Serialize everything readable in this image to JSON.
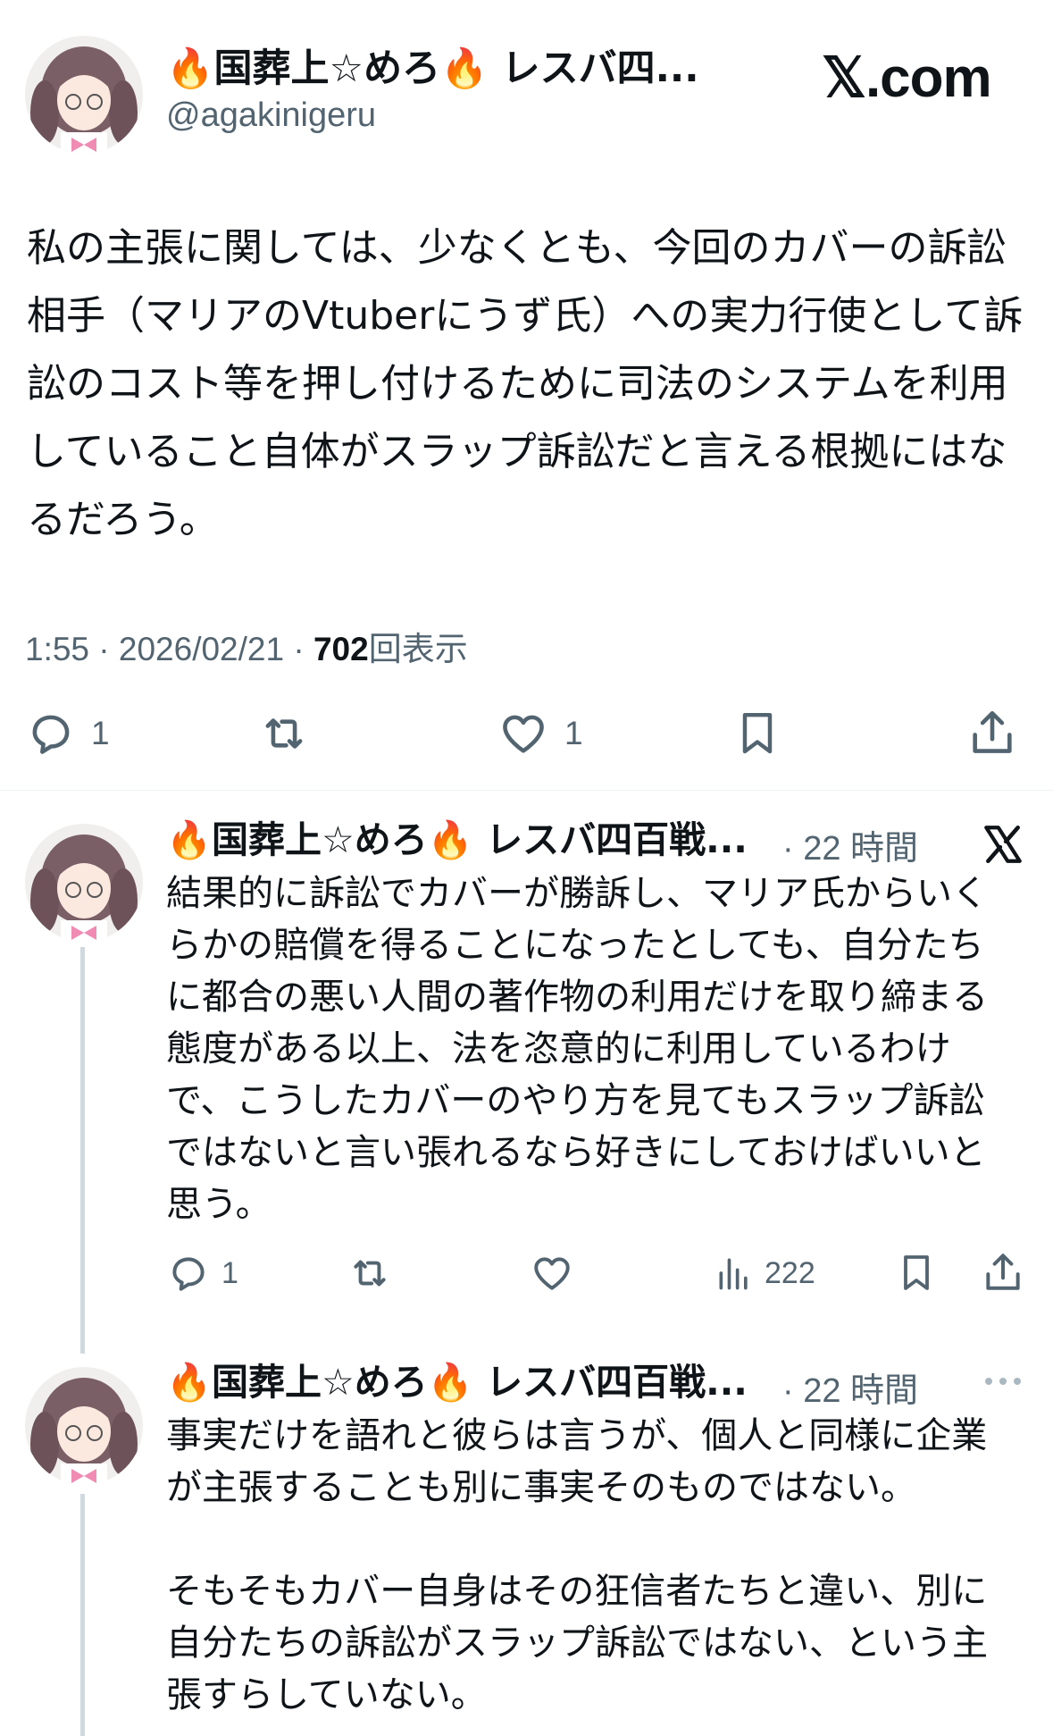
{
  "main_tweet": {
    "author_name": "🔥国葬上☆めろ🔥 レスバ四...",
    "handle": "@agakinigeru",
    "site_label": "𝕏.com",
    "text": "私の主張に関しては、少なくとも、今回のカバーの訴訟相手（マリアのVtuberにうず氏）への実力行使として訴訟のコスト等を押し付けるために司法のシステムを利用していること自体がスラップ訴訟だと言える根拠にはなるだろう。",
    "time": "1:55 · 2026/02/21 · ",
    "views_count": "702",
    "views_label": "回表示",
    "reply_count": "1",
    "like_count": "1"
  },
  "replies": [
    {
      "author_name": "🔥国葬上☆めろ🔥 レスバ四百戦...",
      "time": "· 22 時間",
      "text": "結果的に訴訟でカバーが勝訴し、マリア氏からいくらかの賠償を得ることになったとしても、自分たちに都合の悪い人間の著作物の利用だけを取り締まる態度がある以上、法を恣意的に利用しているわけで、こうしたカバーのやり方を見てもスラップ訴訟ではないと言い張れるなら好きにしておけばいいと思う。",
      "reply_count": "1",
      "views_count": "222"
    },
    {
      "author_name": "🔥国葬上☆めろ🔥 レスバ四百戦...",
      "time": "· 22 時間",
      "text_1": "事実だけを語れと彼らは言うが、個人と同様に企業が主張することも別に事実そのものではない。",
      "text_2": "そもそもカバー自身はその狂信者たちと違い、別に自分たちの訴訟がスラップ訴訟ではない、という主張すらしていない。"
    }
  ],
  "icons": [
    "avatar",
    "reply-icon",
    "retweet-icon",
    "like-icon",
    "bookmark-icon",
    "share-icon",
    "views-icon",
    "x-logo-icon",
    "more-icon"
  ],
  "colors": {
    "text": "#0f1419",
    "secondary": "#536471",
    "thread_line": "#cfd9de",
    "divider": "#eff3f4",
    "avatar_hair": "#7a5f66",
    "avatar_ribbon": "#f08cb4"
  }
}
